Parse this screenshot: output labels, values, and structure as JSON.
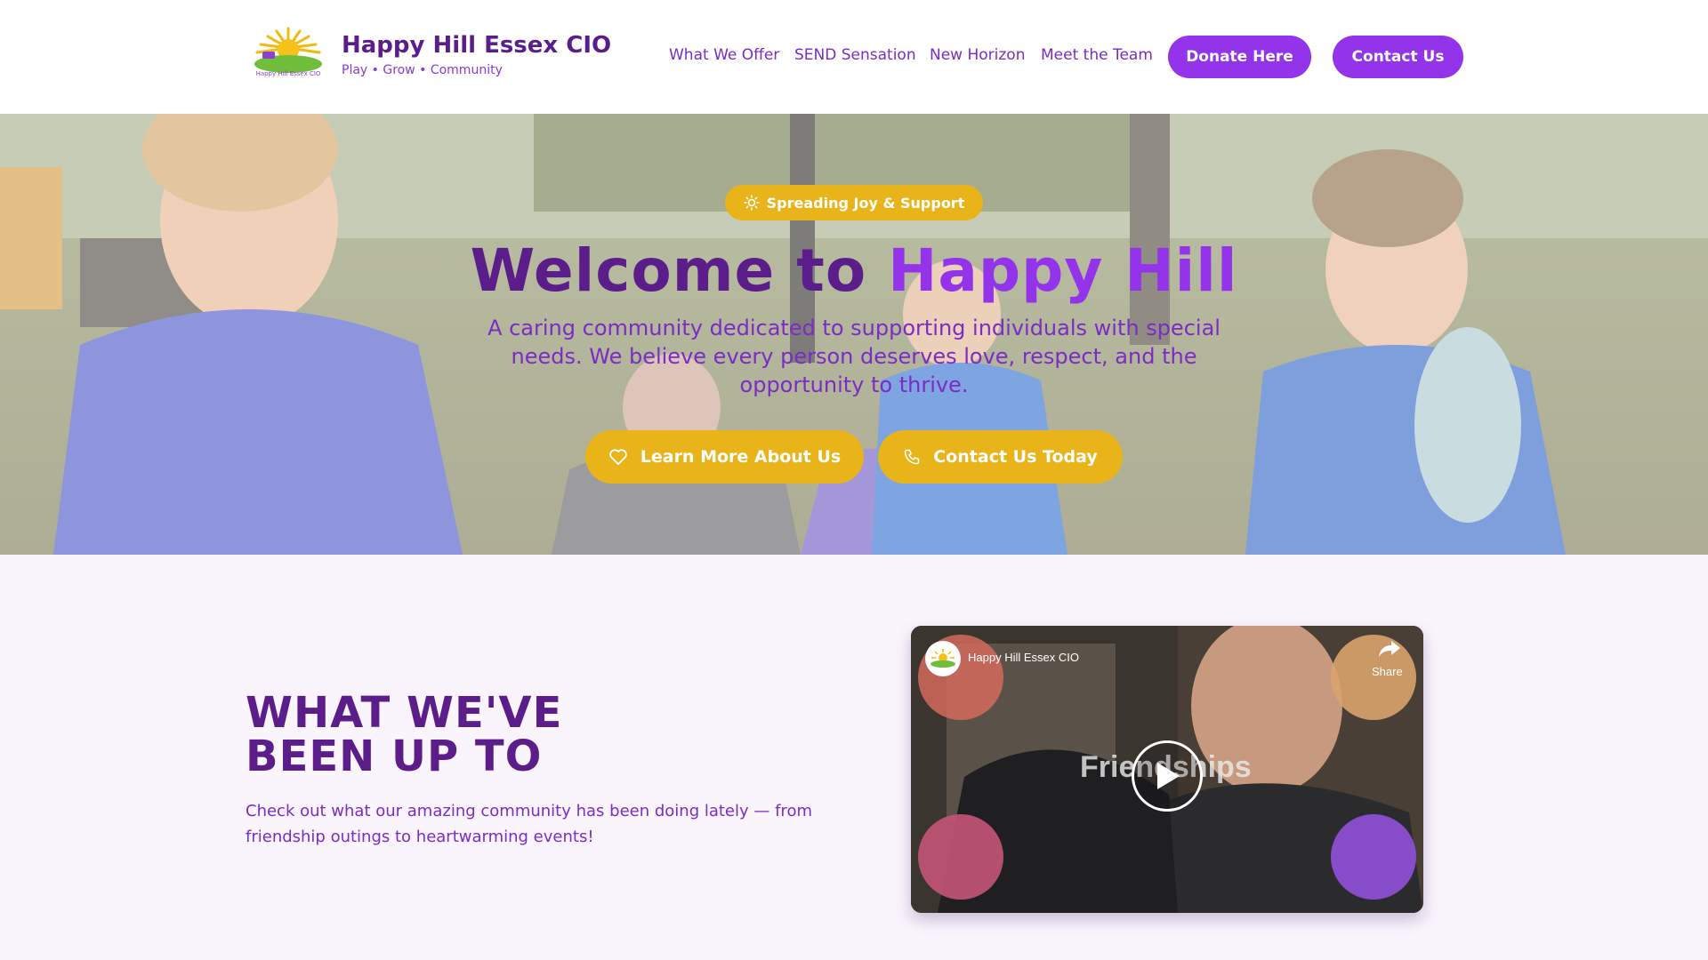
{
  "header": {
    "brand_name": "Happy Hill Essex CIO",
    "brand_tagline": "Play • Grow • Community",
    "logo_text": "Happy Hill Essex CIO",
    "nav": [
      "What We Offer",
      "SEND Sensation",
      "New Horizon",
      "Meet the Team"
    ],
    "donate_label": "Donate Here",
    "contact_label": "Contact Us"
  },
  "hero": {
    "badge": "Spreading Joy & Support",
    "title_main": "Welcome to ",
    "title_accent": "Happy Hill",
    "subtitle": "A caring community dedicated to supporting individuals with special needs. We believe every person deserves love, respect, and the opportunity to thrive.",
    "primary_cta": "Learn More About Us",
    "secondary_cta": "Contact Us Today"
  },
  "section": {
    "title": "WHAT WE'VE BEEN UP TO",
    "description": "Check out what our amazing community has been doing lately — from friendship outings to heartwarming events!"
  },
  "video": {
    "channel_name": "Happy Hill Essex CIO",
    "share_label": "Share",
    "title_overlay": "Friendships"
  },
  "icons": {
    "badge": "sun-icon",
    "primary_cta": "heart-icon",
    "secondary_cta": "phone-icon",
    "video_play": "play-icon",
    "video_share": "share-icon"
  },
  "colors": {
    "primary_purple": "#9333ea",
    "dark_purple": "#5b1d8a",
    "text_purple": "#7b2cc4",
    "gold": "#e8b41a",
    "page_bg": "#faf5fd"
  }
}
